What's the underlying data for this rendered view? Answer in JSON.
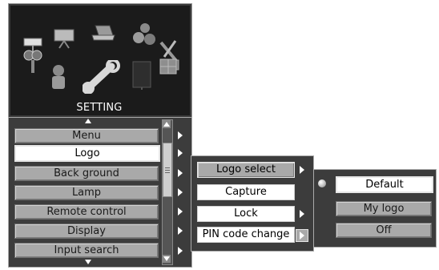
{
  "header": {
    "title": "SETTING",
    "icons": [
      "menu-sign-icon",
      "projection-screen-icon",
      "laptop-icon",
      "color-balls-icon",
      "key-icon",
      "tools-icon",
      "person-icon",
      "wrench-icon",
      "panel-icon",
      "grid-icon"
    ]
  },
  "main_menu": {
    "items": [
      {
        "label": "Menu",
        "selected": false
      },
      {
        "label": "Logo",
        "selected": true
      },
      {
        "label": "Back ground",
        "selected": false
      },
      {
        "label": "Lamp",
        "selected": false
      },
      {
        "label": "Remote control",
        "selected": false
      },
      {
        "label": "Display",
        "selected": false
      },
      {
        "label": "Input search",
        "selected": false
      }
    ]
  },
  "logo_menu": {
    "items": [
      {
        "label": "Logo select",
        "selected": true
      },
      {
        "label": "Capture",
        "selected": false
      },
      {
        "label": "Lock",
        "selected": false
      },
      {
        "label": "PIN code change",
        "selected": false
      }
    ]
  },
  "logo_select_menu": {
    "items": [
      {
        "label": "Default",
        "selected": true
      },
      {
        "label": "My logo",
        "selected": false
      },
      {
        "label": "Off",
        "selected": false
      }
    ]
  },
  "colors": {
    "panel_bg": "#3c3c3c",
    "item_gray": "#a9a9a9",
    "item_selected": "#ffffff",
    "header_bg": "#1b1b1b"
  }
}
